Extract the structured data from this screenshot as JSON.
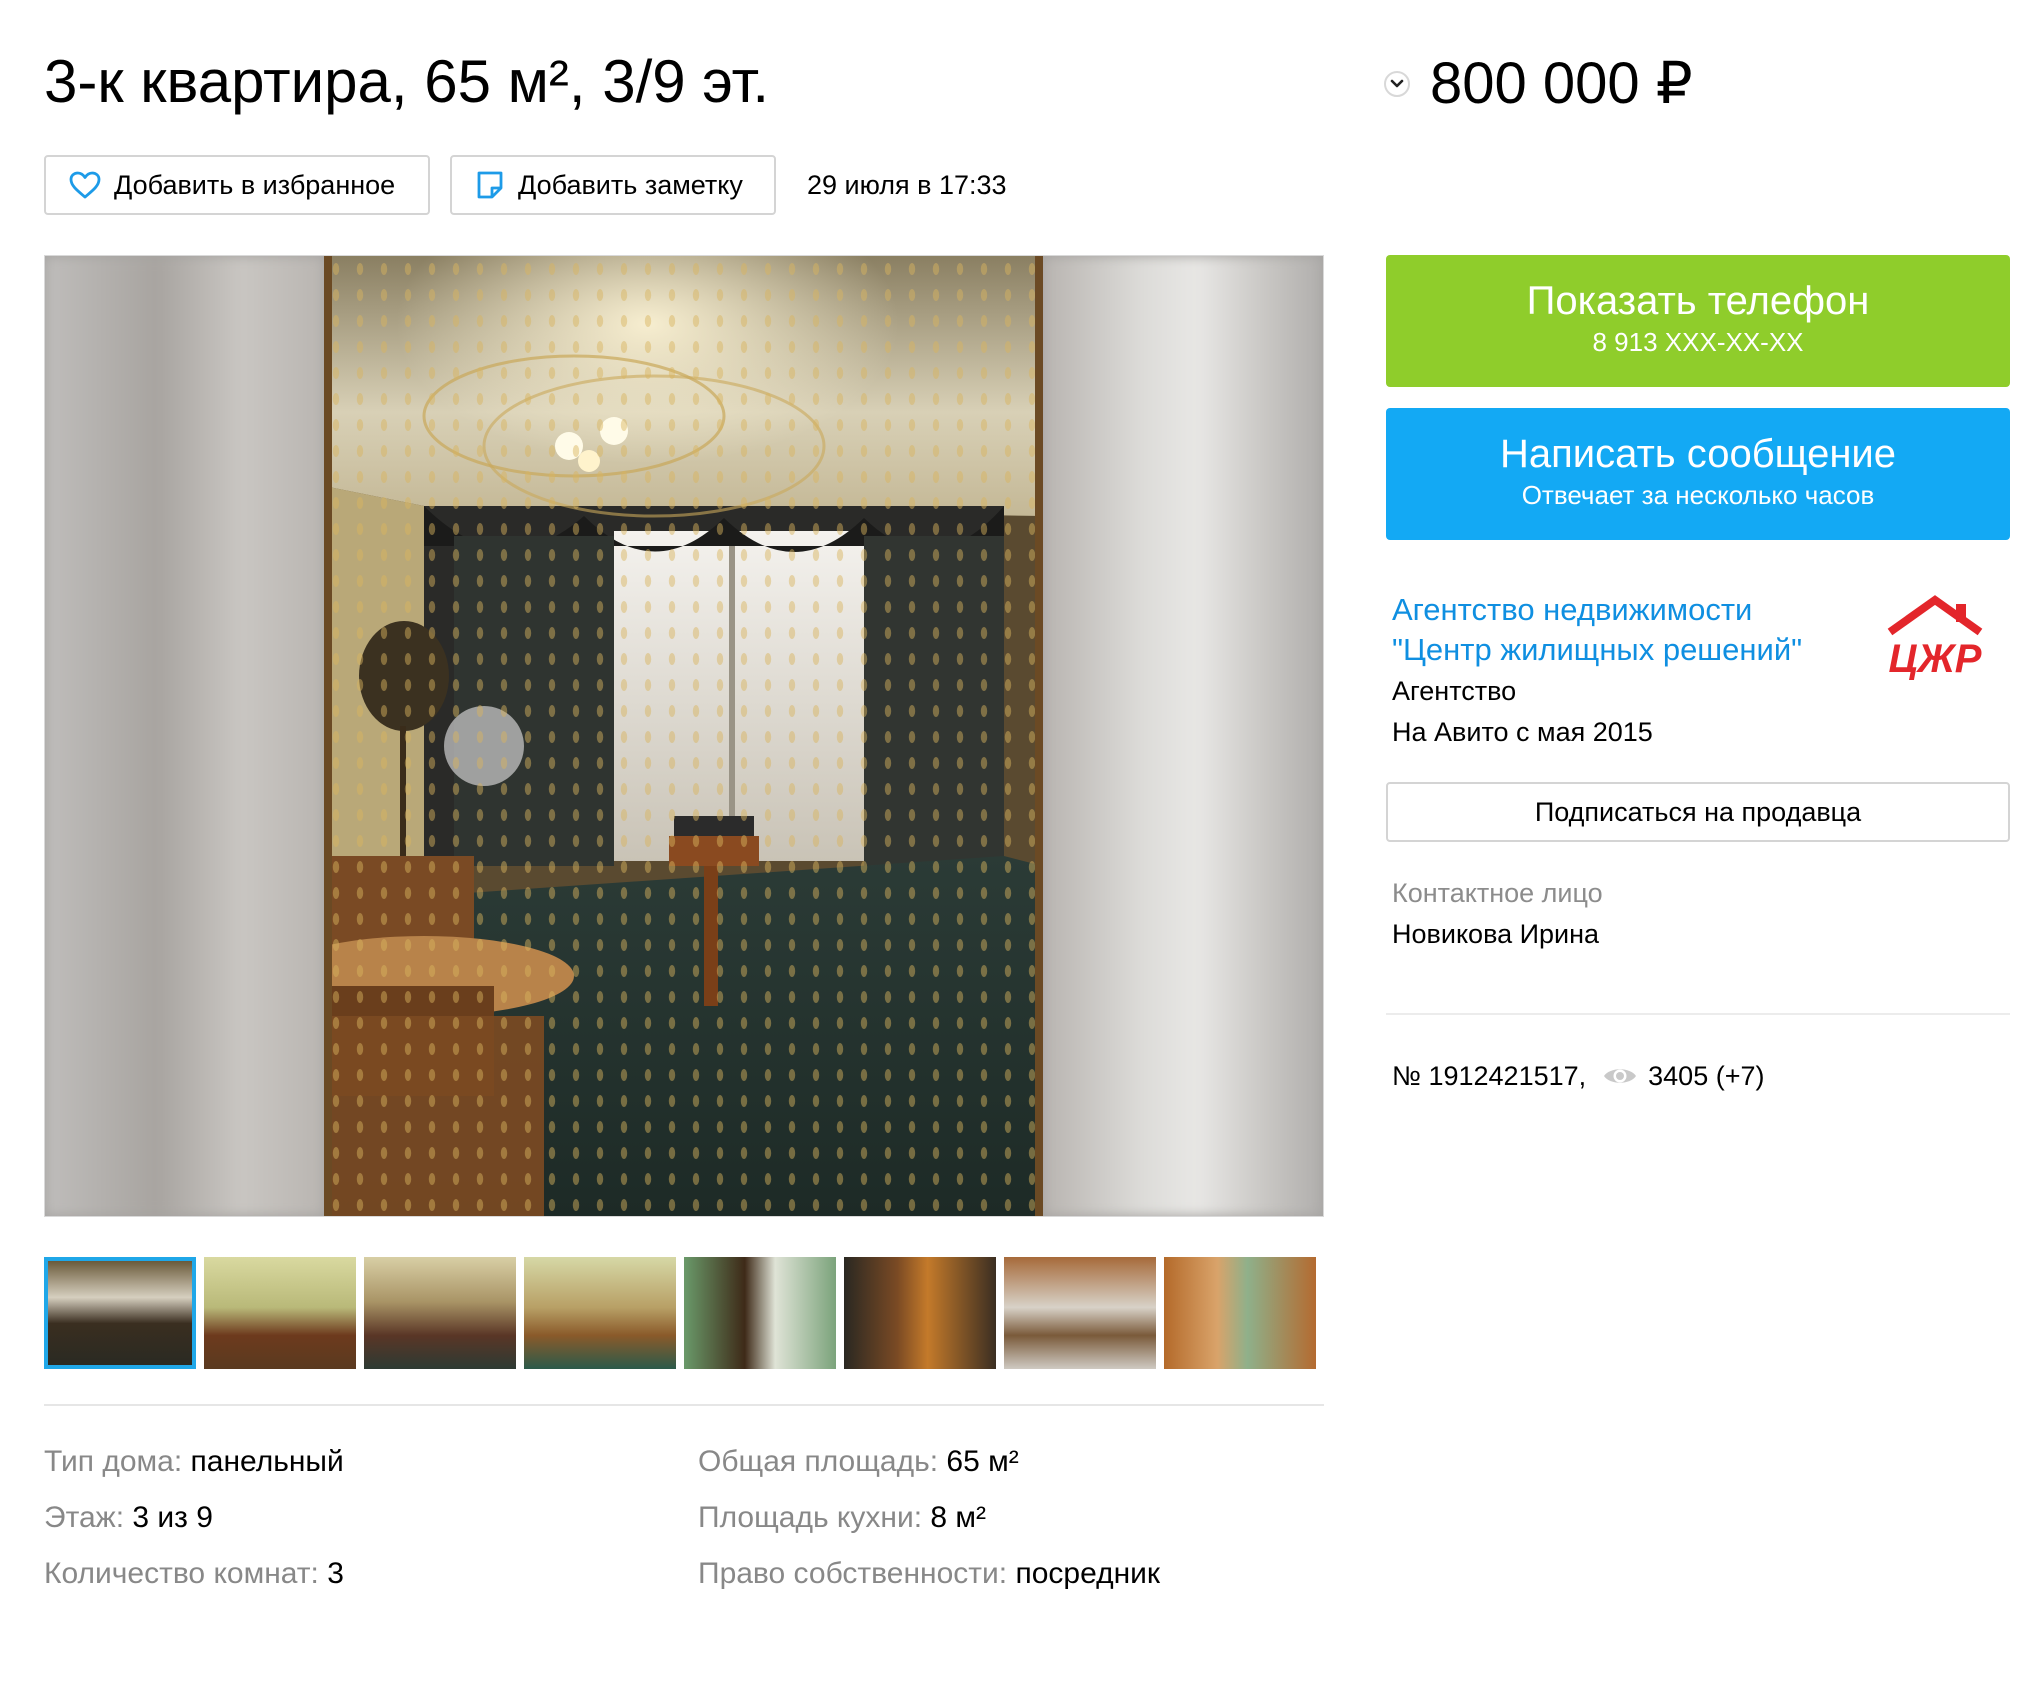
{
  "title": "3-к квартира, 65 м², 3/9 эт.",
  "price": "800 000 ₽",
  "actions": {
    "favorite_label": "Добавить в избранное",
    "note_label": "Добавить заметку",
    "date": "29 июля в 17:33"
  },
  "thumbnails": [
    {
      "name": "photo-1",
      "active": true
    },
    {
      "name": "photo-2",
      "active": false
    },
    {
      "name": "photo-3",
      "active": false
    },
    {
      "name": "photo-4",
      "active": false
    },
    {
      "name": "photo-5",
      "active": false
    },
    {
      "name": "photo-6",
      "active": false
    },
    {
      "name": "photo-7",
      "active": false
    },
    {
      "name": "photo-8",
      "active": false
    }
  ],
  "params": [
    {
      "label": "Тип дома:",
      "value": "панельный"
    },
    {
      "label": "Этаж:",
      "value": "3 из 9"
    },
    {
      "label": "Количество комнат:",
      "value": "3"
    },
    {
      "label": "Общая площадь:",
      "value": "65 м²"
    },
    {
      "label": "Площадь кухни:",
      "value": "8 м²"
    },
    {
      "label": "Право собственности:",
      "value": "посредник"
    }
  ],
  "contact": {
    "phone_button": "Показать телефон",
    "phone_masked": "8 913 XXX-XX-XX",
    "message_button": "Написать сообщение",
    "message_sub": "Отвечает за несколько часов"
  },
  "seller": {
    "name_line1": "Агентство недвижимости",
    "name_line2": "\"Центр жилищных решений\"",
    "type": "Агентство",
    "since": "На Авито с мая 2015",
    "logo_text": "ЦЖР",
    "subscribe_label": "Подписаться на продавца",
    "contact_label": "Контактное лицо",
    "contact_name": "Новикова Ирина"
  },
  "stats": {
    "item_number": "№ 1912421517,",
    "views": "3405 (+7)"
  },
  "colors": {
    "green_button": "#8fcd2b",
    "blue_button": "#13a9f4",
    "link": "#0f8fe1",
    "logo_red": "#e3262b",
    "active_thumb_border": "#1fa7e8"
  },
  "icons": {
    "price_dropdown": "chevron-down-icon",
    "favorite": "heart-icon",
    "note": "note-icon",
    "views": "eye-icon"
  }
}
